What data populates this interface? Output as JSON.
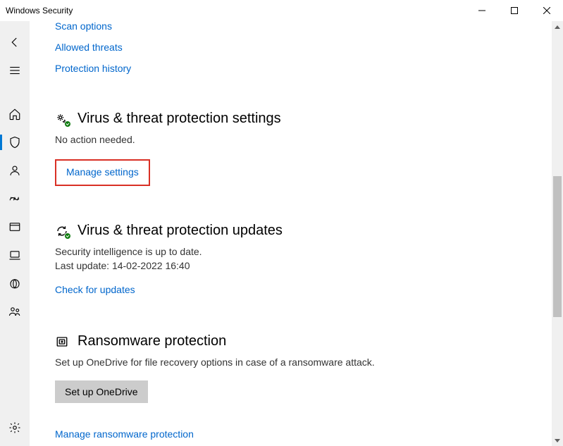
{
  "window": {
    "title": "Windows Security"
  },
  "topLinks": {
    "scanOptions": "Scan options",
    "allowedThreats": "Allowed threats",
    "protectionHistory": "Protection history"
  },
  "settings": {
    "title": "Virus & threat protection settings",
    "desc": "No action needed.",
    "manage": "Manage settings"
  },
  "updates": {
    "title": "Virus & threat protection updates",
    "desc": "Security intelligence is up to date.",
    "lastUpdate": "Last update: 14-02-2022 16:40",
    "check": "Check for updates"
  },
  "ransomware": {
    "title": "Ransomware protection",
    "desc": "Set up OneDrive for file recovery options in case of a ransomware attack.",
    "setup": "Set up OneDrive",
    "manage": "Manage ransomware protection"
  }
}
